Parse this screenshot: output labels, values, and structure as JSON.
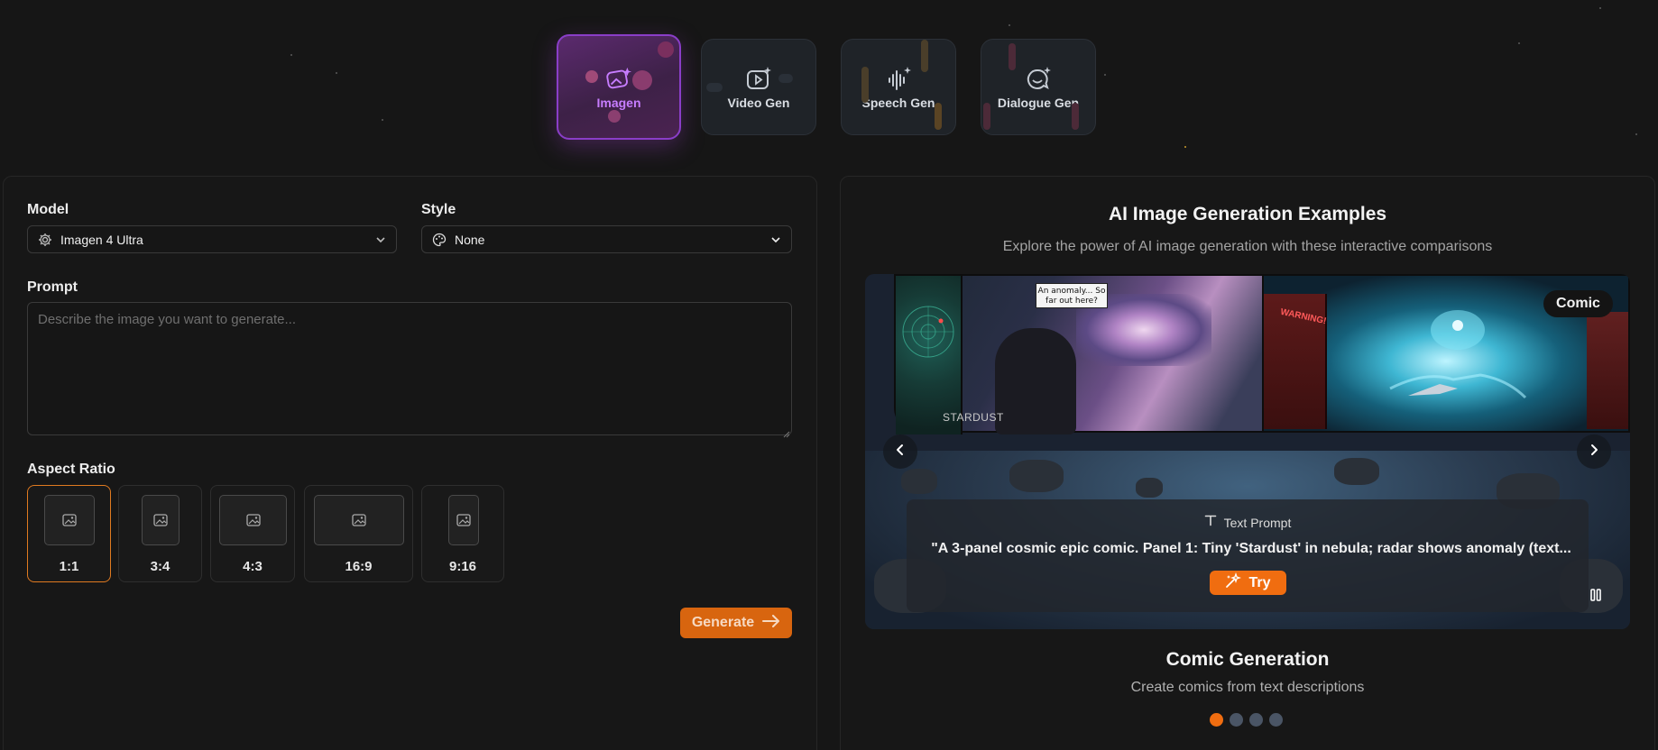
{
  "tabs": [
    {
      "label": "Imagen",
      "icon": "image-sparkle-icon",
      "active": true
    },
    {
      "label": "Video Gen",
      "icon": "video-sparkle-icon",
      "active": false
    },
    {
      "label": "Speech Gen",
      "icon": "audio-wave-sparkle-icon",
      "active": false
    },
    {
      "label": "Dialogue Gen",
      "icon": "chat-sparkle-icon",
      "active": false
    }
  ],
  "form": {
    "model_label": "Model",
    "model_value": "Imagen 4 Ultra",
    "style_label": "Style",
    "style_value": "None",
    "prompt_label": "Prompt",
    "prompt_placeholder": "Describe the image you want to generate...",
    "aspect_label": "Aspect Ratio",
    "aspect_ratios": [
      {
        "label": "1:1",
        "selected": true
      },
      {
        "label": "3:4",
        "selected": false
      },
      {
        "label": "4:3",
        "selected": false
      },
      {
        "label": "16:9",
        "selected": false
      },
      {
        "label": "9:16",
        "selected": false
      }
    ],
    "generate_label": "Generate"
  },
  "examples": {
    "title": "AI Image Generation Examples",
    "subtitle": "Explore the power of AI image generation with these interactive comparisons",
    "badge": "Comic",
    "speech_bubble": "An anomaly... So far out here?",
    "ship_name": "STARDUST",
    "warning_text": "WARNING!",
    "prompt_heading": "Text Prompt",
    "prompt_text": "\"A 3-panel cosmic epic comic. Panel 1: Tiny 'Stardust' in nebula; radar shows anomaly (text...",
    "try_label": "Try",
    "slide_title": "Comic Generation",
    "slide_subtitle": "Create comics from text descriptions",
    "slide_count": 4,
    "active_slide": 1
  },
  "colors": {
    "accent": "#f06d10",
    "generate_bg": "#d8650f",
    "active_tab_border": "#8a3ec8",
    "active_tab_text": "#c77dff",
    "background": "#161616"
  }
}
